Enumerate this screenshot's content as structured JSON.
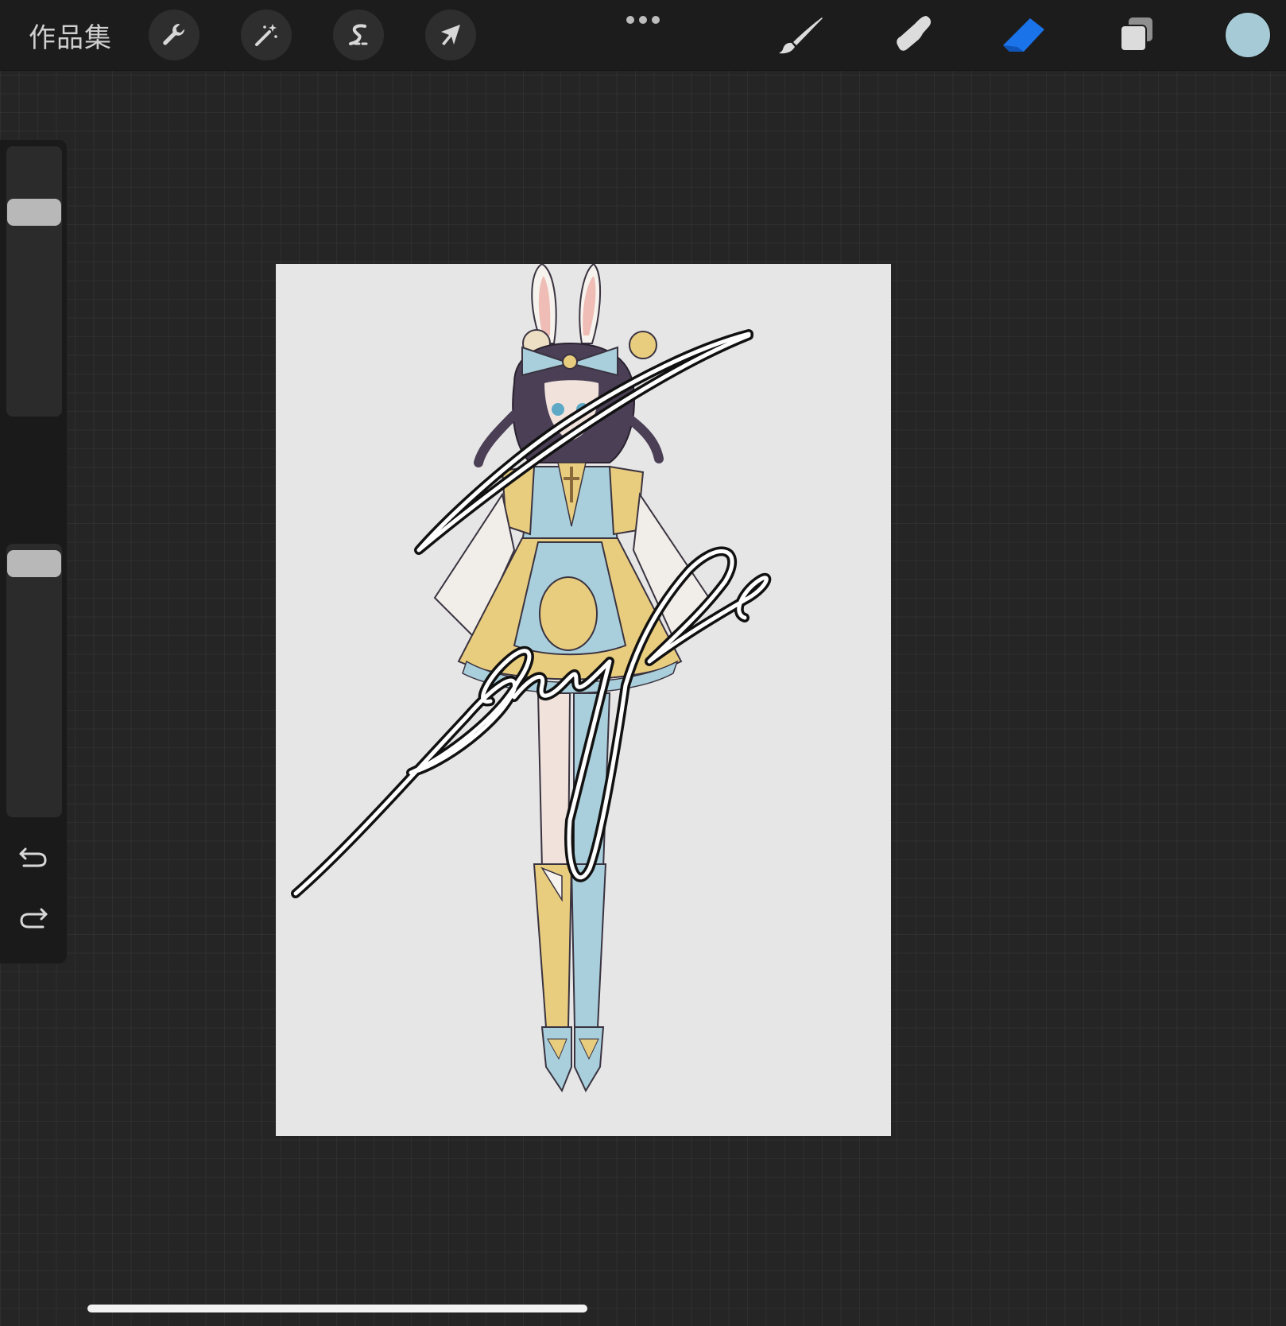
{
  "topbar": {
    "gallery_label": "作品集",
    "left_tools": [
      {
        "name": "actions",
        "icon": "wrench-icon"
      },
      {
        "name": "adjustments",
        "icon": "magic-wand-icon"
      },
      {
        "name": "selection",
        "icon": "selection-s-icon"
      },
      {
        "name": "transform",
        "icon": "arrow-cursor-icon"
      }
    ],
    "more_icon": "more-dots-icon",
    "right_tools": [
      {
        "name": "brush",
        "icon": "brush-icon",
        "active": false
      },
      {
        "name": "smudge",
        "icon": "smudge-finger-icon",
        "active": false
      },
      {
        "name": "eraser",
        "icon": "eraser-icon",
        "active": true
      },
      {
        "name": "layers",
        "icon": "layers-icon",
        "active": false
      }
    ],
    "current_color": "#a7cbd6",
    "active_tool_color": "#1a73e8"
  },
  "sidebar": {
    "size_slider_level": 0.2,
    "opacity_slider_level": 0.0,
    "modify_icon": "square-modify-icon",
    "undo_icon": "undo-icon",
    "redo_icon": "redo-icon"
  },
  "canvas": {
    "artwork": "character-illustration",
    "watermark_text": "Sample",
    "palette": {
      "light_blue": "#a9cfdc",
      "gold": "#e9cd7f",
      "hair": "#4a3f55",
      "skin": "#f1e3dc",
      "background": "#e6e6e6"
    }
  }
}
